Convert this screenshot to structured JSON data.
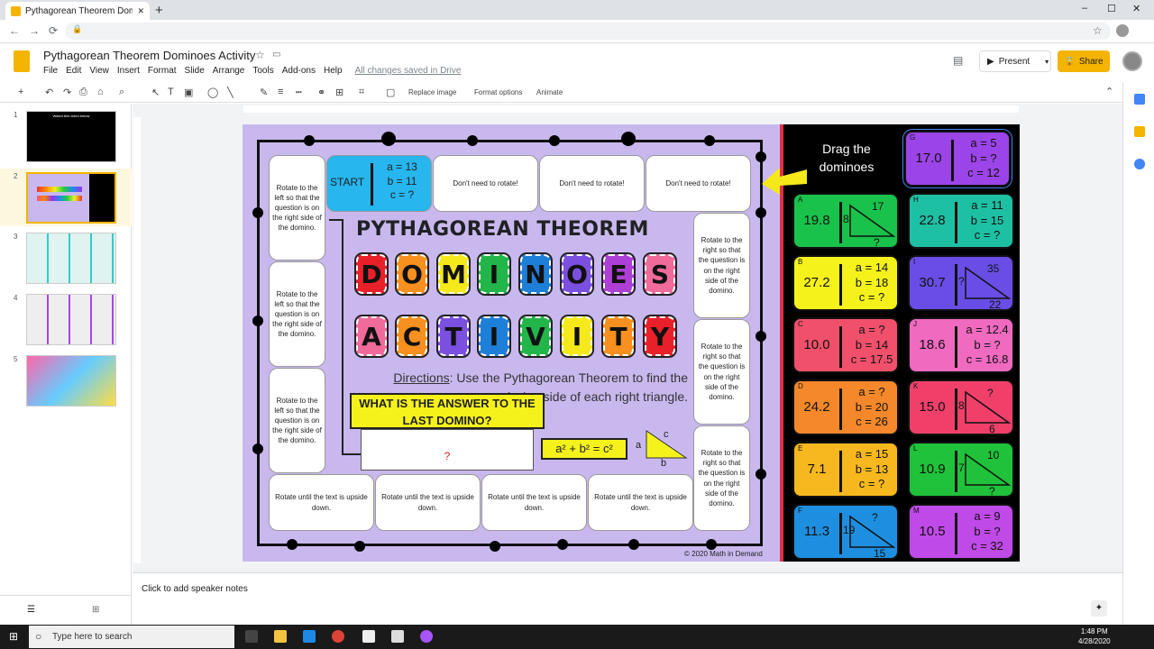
{
  "browser": {
    "tab_title": "Pythagorean Theorem Dominoes",
    "new_tab": "+",
    "min": "–",
    "max": "☐",
    "close": "✕",
    "back": "←",
    "forward": "→",
    "reload": "⟳",
    "lock": "🔒",
    "star": "☆"
  },
  "docs": {
    "title": "Pythagorean Theorem Dominoes Activity",
    "menus": [
      "File",
      "Edit",
      "View",
      "Insert",
      "Format",
      "Slide",
      "Arrange",
      "Tools",
      "Add-ons",
      "Help"
    ],
    "saved": "All changes saved in Drive",
    "present": "Present",
    "share": "Share"
  },
  "toolbar": {
    "replace_image": "Replace image",
    "format_options": "Format options",
    "animate": "Animate"
  },
  "slides": {
    "numbers": [
      "1",
      "2",
      "3",
      "4",
      "5"
    ],
    "thumb1_text": "Watch this video below"
  },
  "notes": {
    "placeholder": "Click to add speaker notes"
  },
  "board": {
    "left_cells": [
      "Rotate to the left so that the question is on the right side of the domino.",
      "Rotate to the left so that the question is on the right side of the domino.",
      "Rotate to the left so that the question is on the right side of the domino."
    ],
    "right_cells": [
      "Rotate to the right so that the question is on the right side of the domino.",
      "Rotate to the right so that the question is on the right side of the domino.",
      "Rotate to the right so that the question is on the right side of the domino."
    ],
    "top_cells": [
      "Don't need to rotate!",
      "Don't need to rotate!",
      "Don't need to rotate!"
    ],
    "bottom_cells": [
      "Rotate until the text is upside down.",
      "Rotate until the text is upside down.",
      "Rotate until the text is upside down.",
      "Rotate until the text is upside down."
    ],
    "start": {
      "label": "START",
      "a": "a = 13",
      "b": "b = 11",
      "c": "c = ?"
    },
    "heading": "PYTHAGOREAN THEOREM",
    "dominoes_letters": [
      "D",
      "O",
      "M",
      "I",
      "N",
      "O",
      "E",
      "S"
    ],
    "activity_letters": [
      "A",
      "C",
      "T",
      "I",
      "V",
      "I",
      "T",
      "Y"
    ],
    "directions_label": "Directions",
    "directions_text": ": Use the Pythagorean Theorem to find the missing side of each right triangle.",
    "question": "WHAT IS THE ANSWER TO THE LAST DOMINO?",
    "answer": "?",
    "formula": "a² + b² = c²",
    "tri_a": "a",
    "tri_b": "b",
    "tri_c": "c",
    "copyright": "© 2020 Math in Demand",
    "drag_text": "Drag the dominoes"
  },
  "dominoes": [
    {
      "letter": "G",
      "value": "17.0",
      "color": "#9b44e8",
      "lines": [
        "a = 5",
        "b = ?",
        "c = 12"
      ]
    },
    {
      "letter": "A",
      "value": "19.8",
      "color": "#19c24a",
      "tri": [
        "8",
        "17",
        "?"
      ]
    },
    {
      "letter": "H",
      "value": "22.8",
      "color": "#1ec0a4",
      "lines": [
        "a = 11",
        "b = 15",
        "c = ?"
      ]
    },
    {
      "letter": "B",
      "value": "27.2",
      "color": "#f5f21b",
      "lines": [
        "a = 14",
        "b = 18",
        "c = ?"
      ]
    },
    {
      "letter": "I",
      "value": "30.7",
      "color": "#6a4de6",
      "tri": [
        "?",
        "35",
        "22"
      ]
    },
    {
      "letter": "C",
      "value": "10.0",
      "color": "#f0506a",
      "lines": [
        "a = ?",
        "b = 14",
        "c = 17.5"
      ]
    },
    {
      "letter": "J",
      "value": "18.6",
      "color": "#f06ac0",
      "lines": [
        "a = 12.4",
        "b = ?",
        "c = 16.8"
      ]
    },
    {
      "letter": "D",
      "value": "24.2",
      "color": "#f4882a",
      "lines": [
        "a = ?",
        "b = 20",
        "c = 26"
      ]
    },
    {
      "letter": "K",
      "value": "15.0",
      "color": "#f0406a",
      "tri": [
        "8",
        "?",
        "6"
      ]
    },
    {
      "letter": "E",
      "value": "7.1",
      "color": "#f7b71e",
      "lines": [
        "a = 15",
        "b = 13",
        "c = ?"
      ]
    },
    {
      "letter": "L",
      "value": "10.9",
      "color": "#1fc23a",
      "tri": [
        "7",
        "10",
        "?"
      ]
    },
    {
      "letter": "F",
      "value": "11.3",
      "color": "#1e8fe0",
      "tri": [
        "19",
        "?",
        "15"
      ]
    },
    {
      "letter": "M",
      "value": "10.5",
      "color": "#c04ae8",
      "lines": [
        "a = 9",
        "b = ?",
        "c = 32"
      ]
    }
  ],
  "taskbar": {
    "search": "Type here to search",
    "time": "1:48 PM",
    "date": "4/28/2020"
  }
}
